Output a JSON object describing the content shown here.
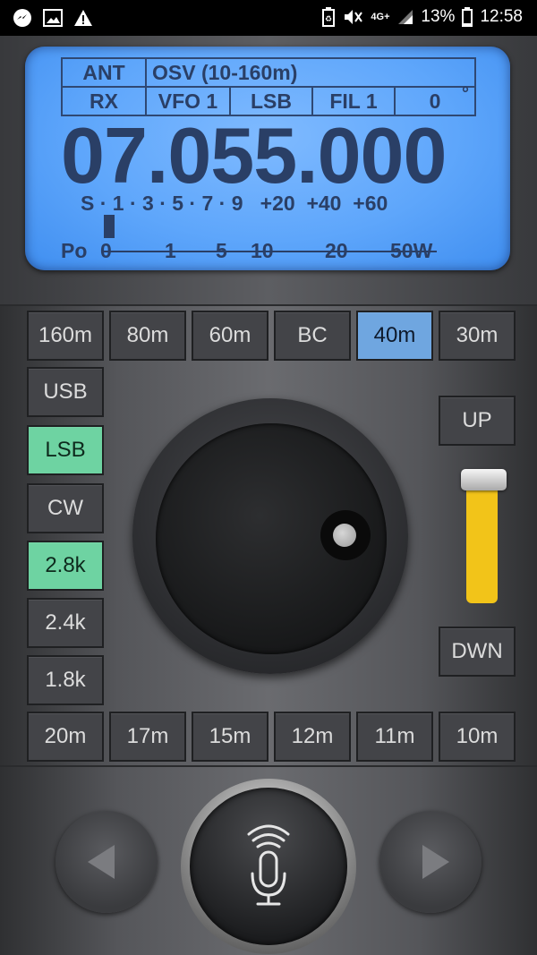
{
  "status_bar": {
    "network": "4G+",
    "battery_percent": "13%",
    "time": "12:58"
  },
  "display": {
    "ant_label": "ANT",
    "ant_value": "OSV (10-160m)",
    "rx_label": "RX",
    "vfo": "VFO 1",
    "mode": "LSB",
    "filter": "FIL 1",
    "offset": "0",
    "degree": "°",
    "frequency": "07.055.000",
    "s_meter_scale": "S · 1 · 3 · 5 · 7 · 9   +20  +40  +60",
    "po_label": "Po",
    "po_ticks": [
      "0",
      "1",
      "5",
      "10",
      "20",
      "50W"
    ]
  },
  "bands_top": [
    "160m",
    "80m",
    "60m",
    "BC",
    "40m",
    "30m"
  ],
  "bands_bottom": [
    "20m",
    "17m",
    "15m",
    "12m",
    "11m",
    "10m"
  ],
  "active_band": "40m",
  "modes": [
    "USB",
    "LSB",
    "CW"
  ],
  "active_mode": "LSB",
  "filters": [
    "2.8k",
    "2.4k",
    "1.8k"
  ],
  "active_filter": "2.8k",
  "tune": {
    "up_label": "UP",
    "down_label": "DWN"
  },
  "colors": {
    "lcd": "#5ea6fb",
    "band_active": "#6fa6e0",
    "mode_active": "#6ed3a2",
    "slider": "#f2c419"
  },
  "icons": {
    "prev": "left-arrow-icon",
    "next": "right-arrow-icon",
    "ptt": "microphone-icon"
  }
}
